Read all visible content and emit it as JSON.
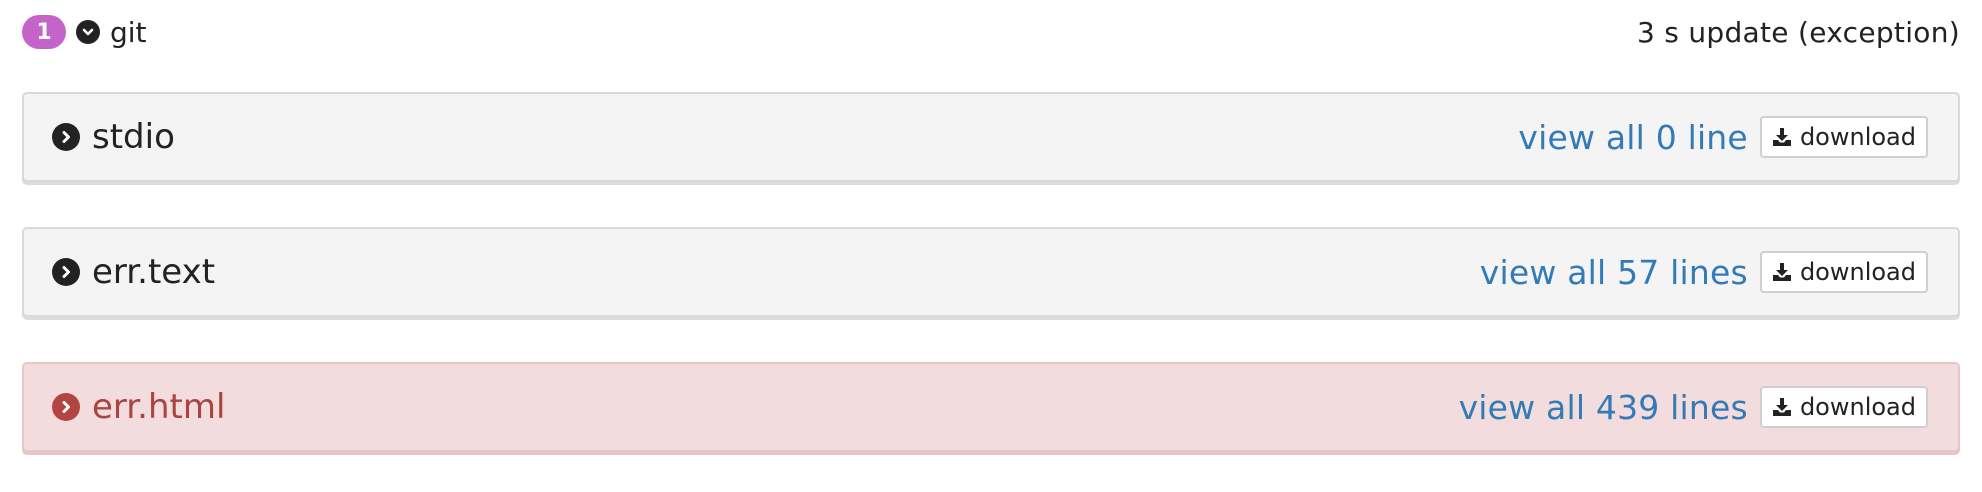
{
  "step": {
    "number": "1",
    "name": "git",
    "status": "3 s update (exception)"
  },
  "logs": [
    {
      "title": "stdio",
      "view_all_label": "view all 0 line",
      "download_label": "download",
      "state": "normal"
    },
    {
      "title": "err.text",
      "view_all_label": "view all 57 lines",
      "download_label": "download",
      "state": "normal"
    },
    {
      "title": "err.html",
      "view_all_label": "view all 439 lines",
      "download_label": "download",
      "state": "error"
    }
  ],
  "icons": {
    "step_toggle": "chevron-down-circle-icon",
    "log_toggle": "chevron-right-circle-icon",
    "download": "download-icon"
  },
  "colors": {
    "badge": "#c463c9",
    "link": "#337ab7",
    "error_text": "#a94442",
    "error_bg": "#f2dcdd"
  }
}
